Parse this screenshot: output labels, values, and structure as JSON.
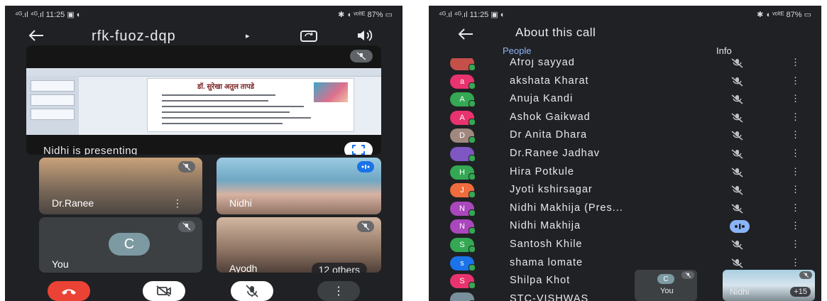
{
  "left_screen": {
    "status_bar": {
      "left": "⁴ᴳ.ıl ⁴ᴳ.ıl 11:25 ▣ ◐",
      "right": "✱ ◖ ᵛᵒˡᵗᴱ 87% ▭"
    },
    "meeting_code": "rfk-fuoz-dqp",
    "presentation": {
      "slide_heading": "डॉ. सुरेखा अतुल तापडे",
      "presenting_label": "Nidhi is presenting"
    },
    "tiles": [
      {
        "name": "Dr.Ranee"
      },
      {
        "name": "Nidhi"
      },
      {
        "name": "You",
        "avatar_letter": "C"
      },
      {
        "name": "Ayodh",
        "others_label": "12 others"
      }
    ],
    "colors": {
      "end_call": "#ea4335",
      "background": "#202124"
    }
  },
  "right_screen": {
    "status_bar": {
      "left": "⁴ᴳ.ıl ⁴ᴳ.ıl 11:25 ▣ ◐",
      "right": "✱ ◖ ᵛᵒˡᵗᴱ 87% ▭"
    },
    "title": "About this call",
    "tabs": [
      {
        "label": "People",
        "active": true
      },
      {
        "label": "Info",
        "active": false
      }
    ],
    "participants": [
      {
        "name": "Afroj sayyad",
        "avatar": "",
        "avatar_color": "#c5504a",
        "status": "muted"
      },
      {
        "name": "akshata Kharat",
        "avatar": "a",
        "avatar_color": "#e8336e",
        "status": "muted"
      },
      {
        "name": "Anuja Kandi",
        "avatar": "A",
        "avatar_color": "#34a853",
        "status": "muted"
      },
      {
        "name": "Ashok Gaikwad",
        "avatar": "A",
        "avatar_color": "#e8336e",
        "status": "muted"
      },
      {
        "name": "Dr Anita Dhara",
        "avatar": "D",
        "avatar_color": "#a1887f",
        "status": "muted"
      },
      {
        "name": "Dr.Ranee Jadhav",
        "avatar": "",
        "avatar_color": "#7e57c2",
        "status": "muted"
      },
      {
        "name": "Hira Potkule",
        "avatar": "H",
        "avatar_color": "#34a853",
        "status": "muted"
      },
      {
        "name": "Jyoti kshirsagar",
        "avatar": "J",
        "avatar_color": "#ef6c3d",
        "status": "muted"
      },
      {
        "name": "Nidhi Makhija (Pres...",
        "avatar": "N",
        "avatar_color": "#ab47bc",
        "status": "muted"
      },
      {
        "name": "Nidhi Makhija",
        "avatar": "N",
        "avatar_color": "#ab47bc",
        "status": "speaking"
      },
      {
        "name": "Santosh Khile",
        "avatar": "S",
        "avatar_color": "#34a853",
        "status": "muted"
      },
      {
        "name": "shama lomate",
        "avatar": "s",
        "avatar_color": "#1a73e8",
        "status": "muted"
      },
      {
        "name": "Shilpa Khot",
        "avatar": "S",
        "avatar_color": "#e8336e",
        "status": ""
      },
      {
        "name": "STC-VISHWAS",
        "avatar": "",
        "avatar_color": "#78909c",
        "status": ""
      }
    ],
    "pip_you": {
      "avatar_letter": "C",
      "label": "You"
    },
    "pip_nidhi": {
      "label": "Nidhi",
      "count": "+15"
    },
    "colors": {
      "accent": "#8ab4f8",
      "background": "#202124"
    }
  }
}
